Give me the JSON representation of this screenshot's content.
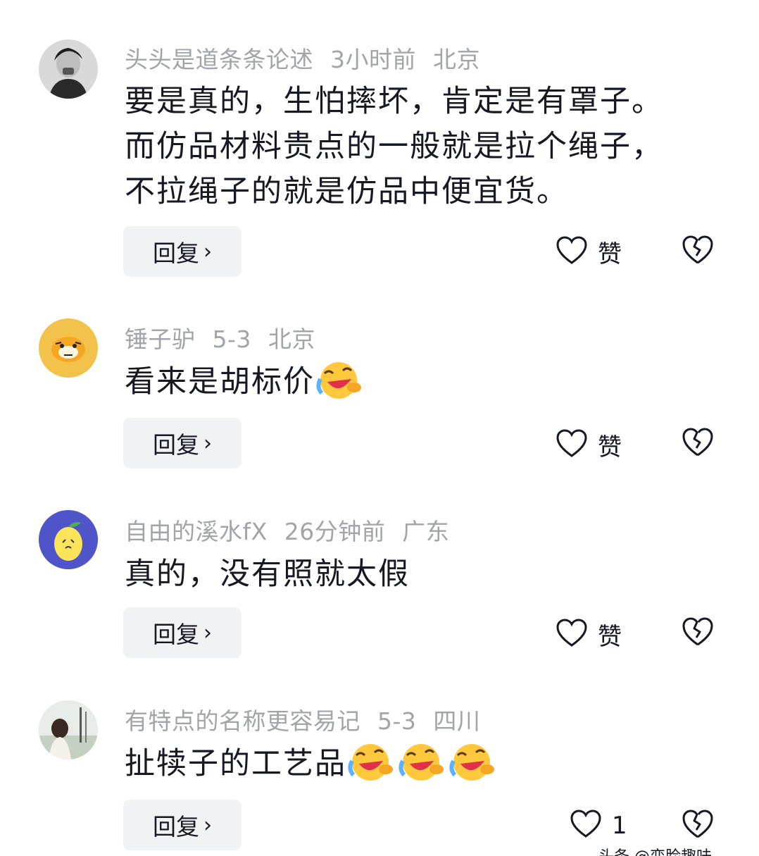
{
  "comments": [
    {
      "username": "头头是道条条论述",
      "time": "3小时前",
      "location": "北京",
      "lines": [
        "要是真的，生怕摔坏，肯定是有罩子。",
        "而仿品材料贵点的一般就是拉个绳子，",
        "不拉绳子的就是仿品中便宜货。"
      ],
      "reply_label": "回复",
      "like_label": "赞",
      "avatar_icon": "person-photo-avatar"
    },
    {
      "username": "锤子驴",
      "time": "5-3",
      "location": "北京",
      "text": "看来是胡标价",
      "emojis": [
        "laughing-crying-emoji"
      ],
      "reply_label": "回复",
      "like_label": "赞",
      "avatar_icon": "tiger-avatar"
    },
    {
      "username": "自由的溪水fX",
      "time": "26分钟前",
      "location": "广东",
      "text": "真的，没有照就太假",
      "reply_label": "回复",
      "like_label": "赞",
      "avatar_icon": "lemon-avatar"
    },
    {
      "username": "有特点的名称更容易记",
      "time": "5-3",
      "location": "四川",
      "text": "扯犊子的工艺品",
      "emojis": [
        "laughing-crying-emoji",
        "laughing-crying-emoji",
        "laughing-crying-emoji"
      ],
      "reply_label": "回复",
      "like_label": "1",
      "avatar_icon": "girl-photo-avatar"
    }
  ],
  "watermark": "头条 @变脸趣味",
  "colors": {
    "meta": "#a3a4a9",
    "text": "#161823",
    "button_bg": "#f1f2f4"
  }
}
